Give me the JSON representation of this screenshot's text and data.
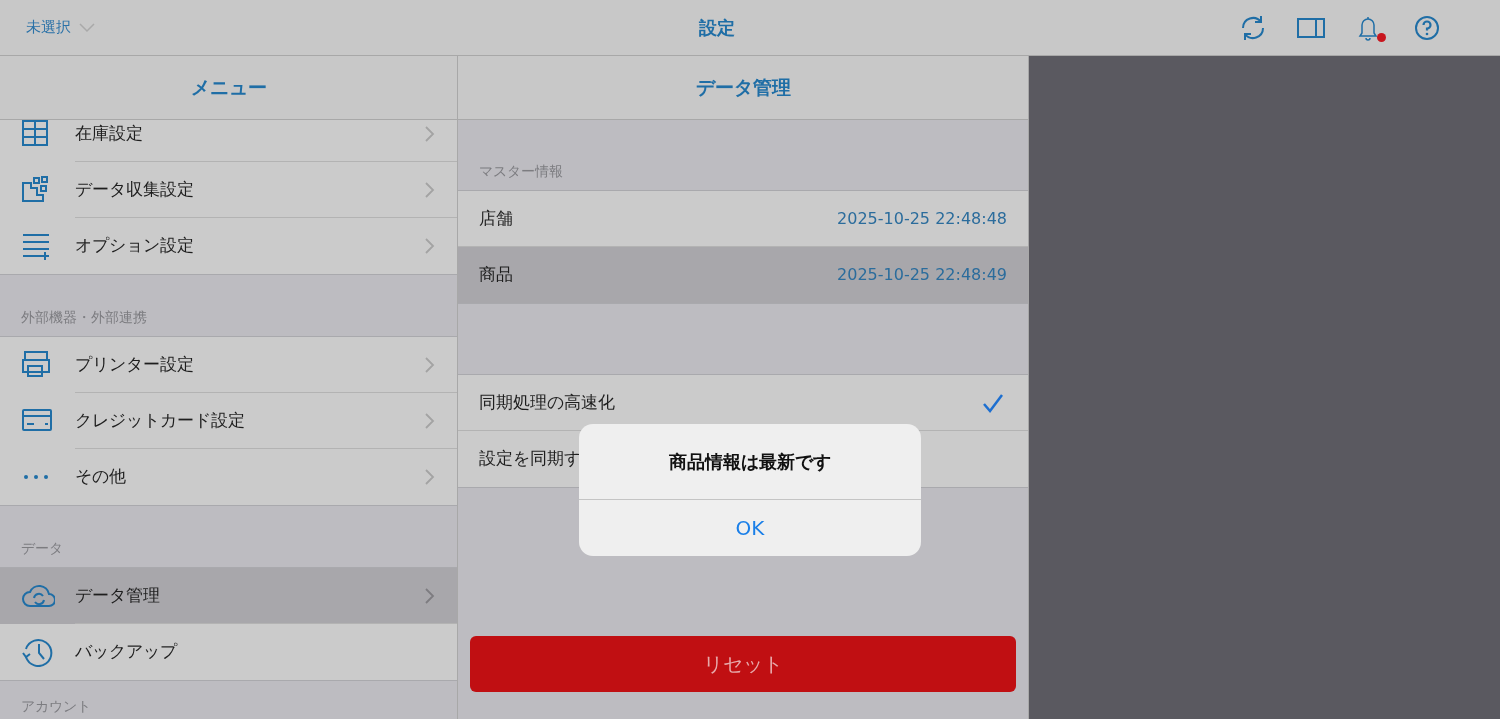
{
  "top_bar": {
    "store_selector": "未選択",
    "title": "設定",
    "notification_badge": true
  },
  "menu": {
    "title": "メニュー",
    "sections": [
      {
        "items": [
          {
            "label": "在庫設定",
            "selected": false
          },
          {
            "label": "データ収集設定",
            "selected": false
          },
          {
            "label": "オプション設定",
            "selected": false
          }
        ]
      },
      {
        "label": "外部機器・外部連携",
        "items": [
          {
            "label": "プリンター設定",
            "selected": false
          },
          {
            "label": "クレジットカード設定",
            "selected": false
          },
          {
            "label": "その他",
            "selected": false
          }
        ]
      },
      {
        "label": "データ",
        "items": [
          {
            "label": "データ管理",
            "selected": true
          },
          {
            "label": "バックアップ",
            "selected": false
          }
        ]
      },
      {
        "label": "アカウント"
      }
    ]
  },
  "detail": {
    "title": "データ管理",
    "section_label": "マスター情報",
    "master_rows": [
      {
        "label": "店舗",
        "value": "2025-10-25 22:48:48",
        "selected": false
      },
      {
        "label": "商品",
        "value": "2025-10-25 22:48:49",
        "selected": true
      }
    ],
    "option_rows": [
      {
        "label": "同期処理の高速化",
        "checked": true
      },
      {
        "label": "設定を同期す",
        "checked": false
      }
    ],
    "reset_button": "リセット"
  },
  "alert": {
    "message": "商品情報は最新です",
    "button": "OK"
  }
}
